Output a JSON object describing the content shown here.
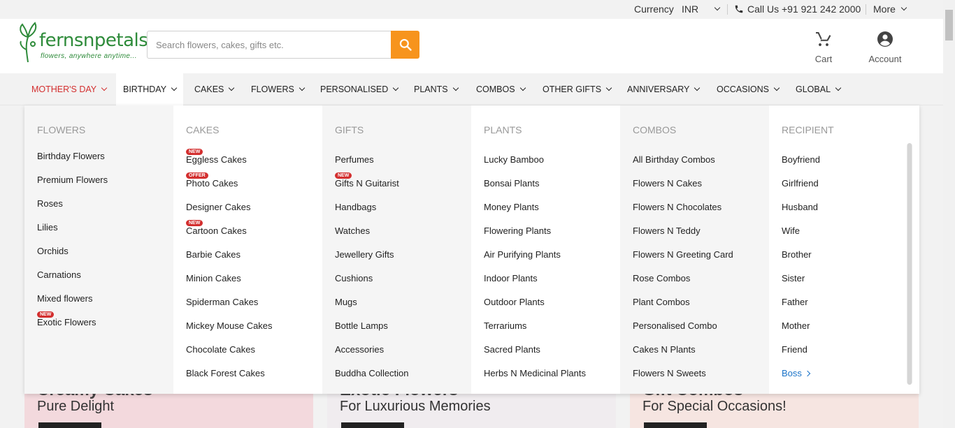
{
  "topbar": {
    "currency_label": "Currency",
    "currency_value": "INR",
    "call_label": "Call Us +91 921 242 2000",
    "more_label": "More"
  },
  "logo": {
    "brand": "fernsnpetals",
    "tagline": "flowers, anywhere anytime..."
  },
  "search": {
    "placeholder": "Search flowers, cakes, gifts etc."
  },
  "header": {
    "cart_label": "Cart",
    "account_label": "Account"
  },
  "nav": [
    {
      "label": "MOTHER'S DAY",
      "style": "red"
    },
    {
      "label": "BIRTHDAY",
      "style": "active"
    },
    {
      "label": "CAKES",
      "style": ""
    },
    {
      "label": "FLOWERS",
      "style": ""
    },
    {
      "label": "PERSONALISED",
      "style": ""
    },
    {
      "label": "PLANTS",
      "style": ""
    },
    {
      "label": "COMBOS",
      "style": ""
    },
    {
      "label": "OTHER GIFTS",
      "style": ""
    },
    {
      "label": "ANNIVERSARY",
      "style": ""
    },
    {
      "label": "OCCASIONS",
      "style": ""
    },
    {
      "label": "GLOBAL",
      "style": ""
    }
  ],
  "mega_menu": [
    {
      "heading": "FLOWERS",
      "links": [
        {
          "label": "Birthday Flowers"
        },
        {
          "label": "Premium Flowers"
        },
        {
          "label": "Roses"
        },
        {
          "label": "Lilies"
        },
        {
          "label": "Orchids"
        },
        {
          "label": "Carnations"
        },
        {
          "label": "Mixed flowers"
        },
        {
          "label": "Exotic Flowers",
          "badge": "NEW"
        }
      ]
    },
    {
      "heading": "CAKES",
      "links": [
        {
          "label": "Eggless Cakes",
          "badge": "NEW"
        },
        {
          "label": "Photo Cakes",
          "badge": "OFFER"
        },
        {
          "label": "Designer Cakes"
        },
        {
          "label": "Cartoon Cakes",
          "badge": "NEW"
        },
        {
          "label": "Barbie Cakes"
        },
        {
          "label": "Minion Cakes"
        },
        {
          "label": "Spiderman Cakes"
        },
        {
          "label": "Mickey Mouse Cakes"
        },
        {
          "label": "Chocolate Cakes"
        },
        {
          "label": "Black Forest Cakes"
        }
      ]
    },
    {
      "heading": "GIFTS",
      "links": [
        {
          "label": "Perfumes"
        },
        {
          "label": "Gifts N Guitarist",
          "badge": "NEW"
        },
        {
          "label": "Handbags"
        },
        {
          "label": "Watches"
        },
        {
          "label": "Jewellery Gifts"
        },
        {
          "label": "Cushions"
        },
        {
          "label": "Mugs"
        },
        {
          "label": "Bottle Lamps"
        },
        {
          "label": "Accessories"
        },
        {
          "label": "Buddha Collection"
        }
      ]
    },
    {
      "heading": "PLANTS",
      "links": [
        {
          "label": "Lucky Bamboo"
        },
        {
          "label": "Bonsai Plants"
        },
        {
          "label": "Money Plants"
        },
        {
          "label": "Flowering Plants"
        },
        {
          "label": "Air Purifying Plants"
        },
        {
          "label": "Indoor Plants"
        },
        {
          "label": "Outdoor Plants"
        },
        {
          "label": "Terrariums"
        },
        {
          "label": "Sacred Plants"
        },
        {
          "label": "Herbs N Medicinal Plants"
        }
      ]
    },
    {
      "heading": "COMBOS",
      "links": [
        {
          "label": "All Birthday Combos"
        },
        {
          "label": "Flowers N Cakes"
        },
        {
          "label": "Flowers N Chocolates"
        },
        {
          "label": "Flowers N Teddy"
        },
        {
          "label": "Flowers N Greeting Card"
        },
        {
          "label": "Rose Combos"
        },
        {
          "label": "Plant Combos"
        },
        {
          "label": "Personalised Combo"
        },
        {
          "label": "Cakes N Plants"
        },
        {
          "label": "Flowers N Sweets"
        }
      ]
    },
    {
      "heading": "RECIPIENT",
      "links": [
        {
          "label": "Boyfriend"
        },
        {
          "label": "Girlfriend"
        },
        {
          "label": "Husband"
        },
        {
          "label": "Wife"
        },
        {
          "label": "Brother"
        },
        {
          "label": "Sister"
        },
        {
          "label": "Father"
        },
        {
          "label": "Mother"
        },
        {
          "label": "Friend"
        },
        {
          "label": "Boss",
          "style": "blue",
          "chevron": true
        }
      ]
    }
  ],
  "promos": [
    {
      "line1": "Creamy Cakes",
      "line2": "Pure Delight",
      "bg": "#f3d9dd"
    },
    {
      "line1": "Exotic Flowers",
      "line2": "For Luxurious Memories",
      "bg": "#f0ecef"
    },
    {
      "line1": "Gift Combos",
      "line2": "For Special Occasions!",
      "bg": "#f6e5e1"
    }
  ],
  "colors": {
    "brand_green": "#2e8b3a",
    "accent_orange": "#f7941d",
    "nav_highlight_red": "#d32f2f",
    "badge_red": "#d32f2f",
    "link_blue": "#1a73c8"
  }
}
